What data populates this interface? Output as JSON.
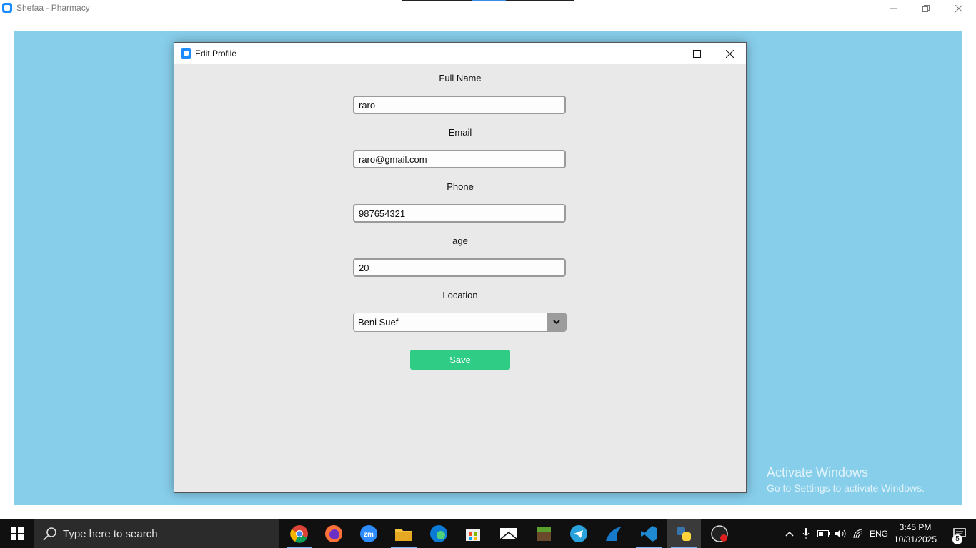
{
  "outer_window": {
    "title": "Shefaa - Pharmacy"
  },
  "dialog": {
    "title": "Edit Profile",
    "fields": [
      {
        "label": "Full Name",
        "value": "raro"
      },
      {
        "label": "Email",
        "value": "raro@gmail.com"
      },
      {
        "label": "Phone",
        "value": "987654321"
      },
      {
        "label": "age",
        "value": "20"
      }
    ],
    "location": {
      "label": "Location",
      "selected": "Beni Suef"
    },
    "save_label": "Save",
    "save_color": "#2ecc85"
  },
  "background_color": "#87ceeb",
  "watermark": {
    "activate_title": "Activate Windows",
    "activate_subtitle": "Go to Settings to activate Windows."
  },
  "taskbar": {
    "search_placeholder": "Type here to search",
    "apps": [
      "chrome-icon",
      "firefox-icon",
      "zoom-icon",
      "file-explorer-icon",
      "edge-icon",
      "store-icon",
      "mail-icon",
      "minecraft-icon",
      "telegram-icon",
      "wireshark-icon",
      "vscode-icon",
      "python-icon",
      "obs-icon"
    ],
    "language": "ENG",
    "time": "3:45 PM",
    "date": "10/31/2025",
    "notification_count": "5"
  }
}
